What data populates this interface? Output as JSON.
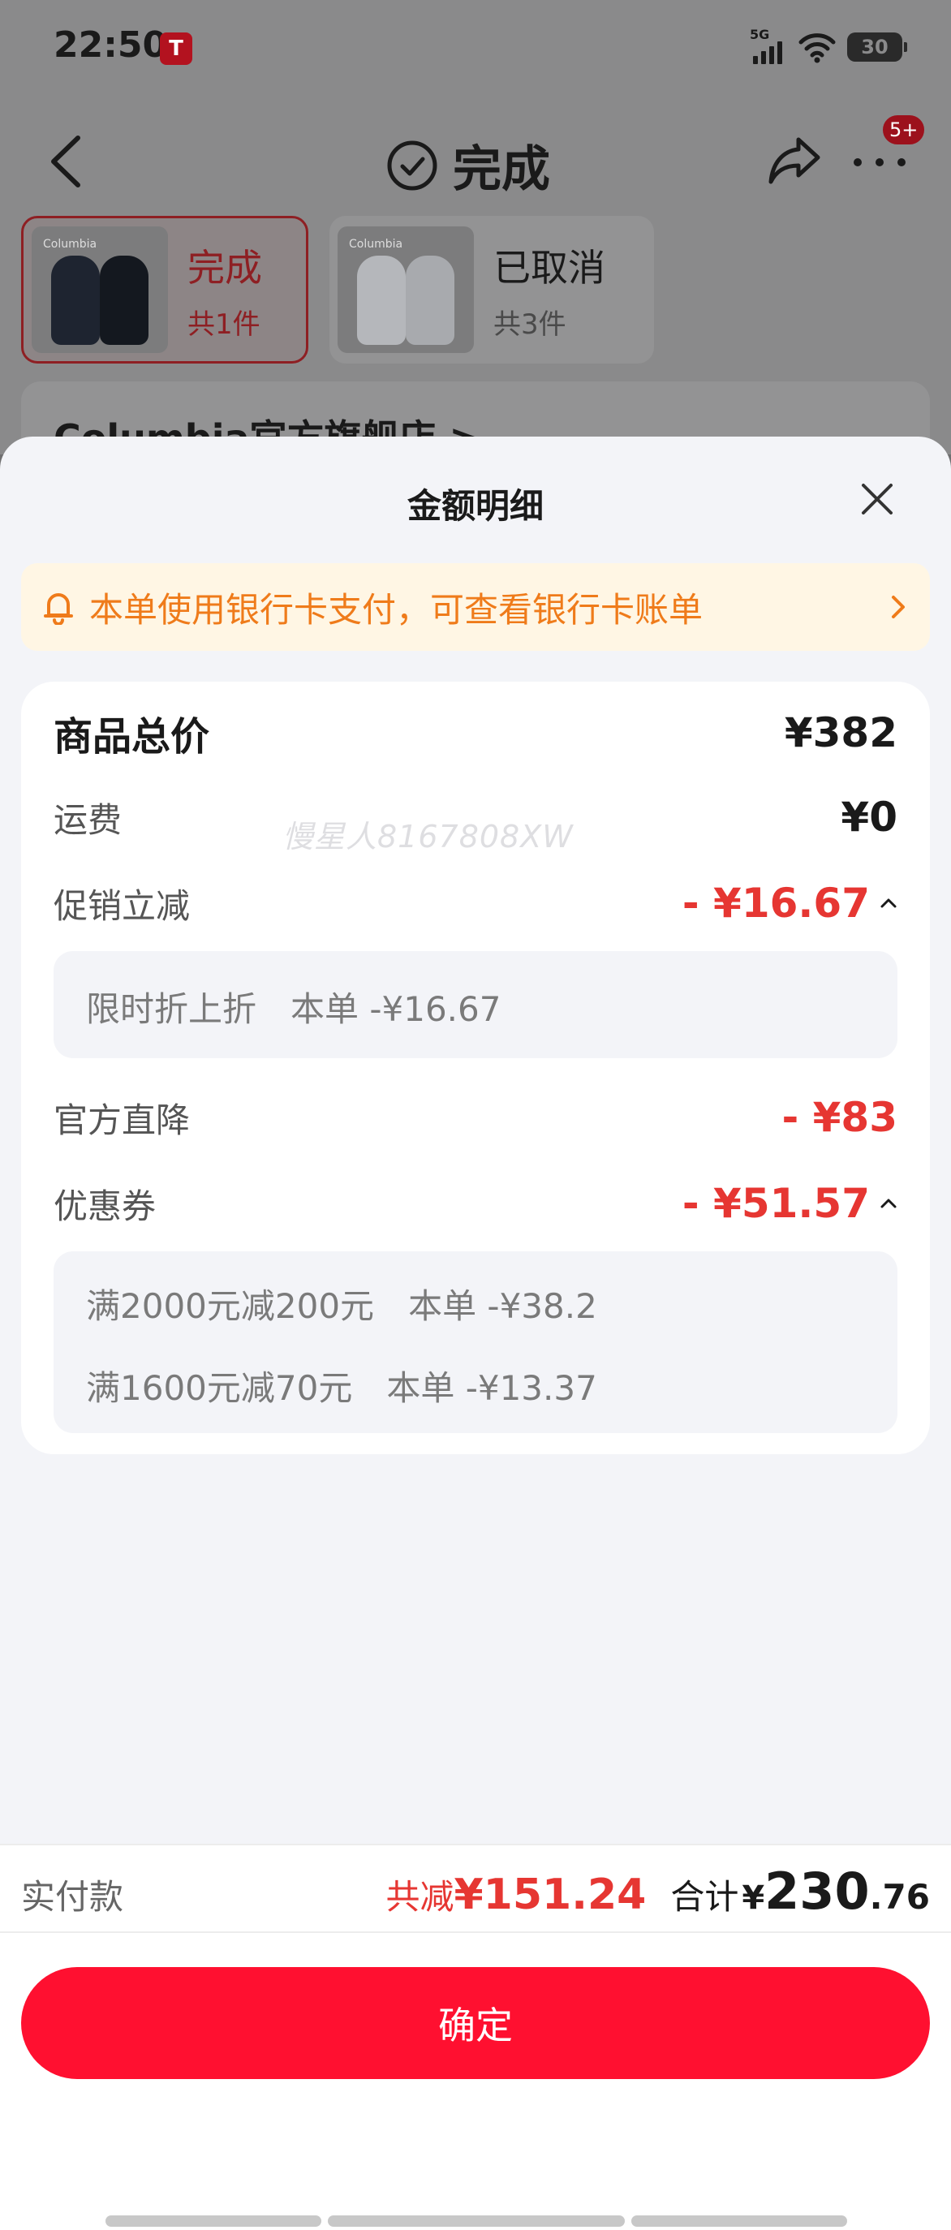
{
  "status": {
    "time": "22:50",
    "network": "5G",
    "battery": "30"
  },
  "nav": {
    "title": "完成",
    "badge": "5+"
  },
  "order_tabs": [
    {
      "title": "完成",
      "count": "共1件",
      "brand": "Columbia"
    },
    {
      "title": "已取消",
      "count": "共3件",
      "brand": "Columbia"
    }
  ],
  "store": {
    "name": "Columbia官方旗舰店 >"
  },
  "sheet": {
    "title": "金额明细",
    "notice": "本单使用银行卡支付，可查看银行卡账单",
    "watermark": "慢星人8167808XW",
    "rows": {
      "total": {
        "label": "商品总价",
        "value": "¥382"
      },
      "shipping": {
        "label": "运费",
        "value": "¥0"
      },
      "promo": {
        "label": "促销立减",
        "value": "- ¥16.67"
      },
      "official": {
        "label": "官方直降",
        "value": "- ¥83"
      },
      "coupon": {
        "label": "优惠券",
        "value": "- ¥51.57"
      }
    },
    "promo_details": [
      {
        "name": "限时折上折",
        "amount": "本单 -¥16.67"
      }
    ],
    "coupon_details": [
      {
        "name": "满2000元减200元",
        "amount": "本单 -¥38.2"
      },
      {
        "name": "满1600元减70元",
        "amount": "本单 -¥13.37"
      }
    ]
  },
  "payment": {
    "label": "实付款",
    "saved_label": "共减",
    "saved_amount": "¥151.24",
    "total_label": "合计",
    "currency": "¥",
    "total_int": "230",
    "total_dec": ".76"
  },
  "confirm_label": "确定",
  "colors": {
    "accent": "#ff1030",
    "discount": "#e63632",
    "notice": "#ef7b1a"
  }
}
